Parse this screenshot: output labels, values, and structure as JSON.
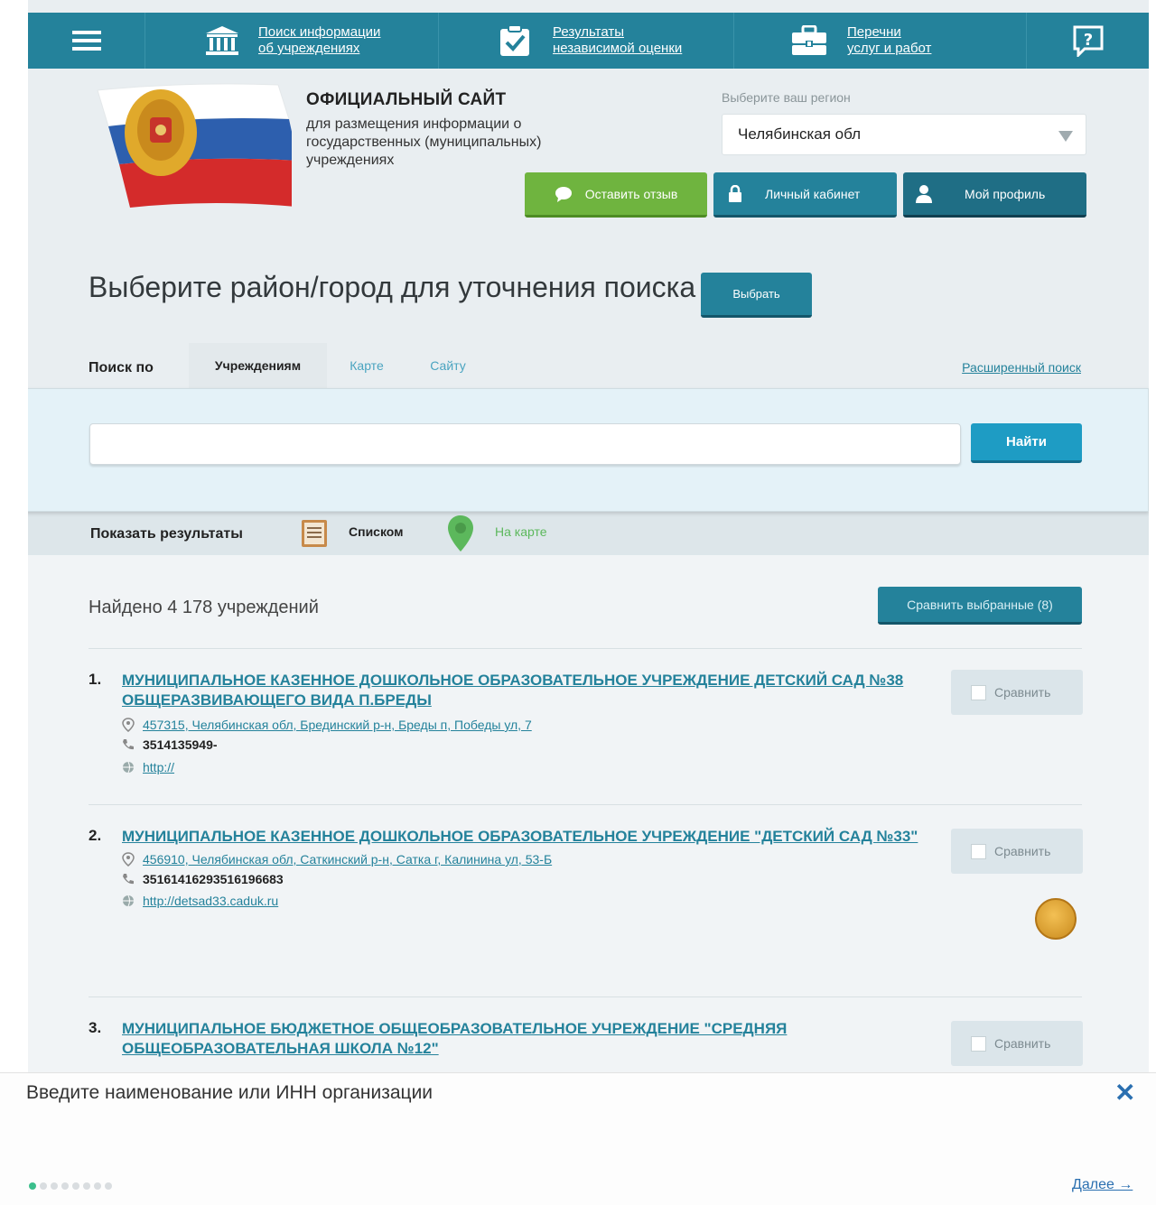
{
  "topnav": {
    "menu_icon": "hamburger-icon",
    "items": [
      {
        "label": "Поиск информации",
        "label2": "об учреждениях",
        "icon": "building-icon"
      },
      {
        "label": "Результаты",
        "label2": "независимой оценки",
        "icon": "checkmark-clipboard-icon"
      },
      {
        "label": "Перечни",
        "label2": "услуг и работ",
        "icon": "briefcase-icon"
      }
    ],
    "help_icon": "help-icon"
  },
  "header": {
    "title": "ОФИЦИАЛЬНЫЙ САЙТ",
    "subtitle": "для размещения информации о государственных (муниципальных) учреждениях",
    "region_label": "Выберите ваш регион",
    "region_value": "Челябинская обл",
    "feedback_button": "Оставить отзыв",
    "cabinet_button": "Личный кабинет",
    "profile_button": "Мой профиль"
  },
  "district": {
    "heading": "Выберите район/город для уточнения поиска",
    "button": "Выбрать"
  },
  "search": {
    "by_label": "Поиск по",
    "tabs": [
      "Учреждениям",
      "Карте",
      "Сайту"
    ],
    "advanced": "Расширенный поиск",
    "input_value": "",
    "button": "Найти"
  },
  "show": {
    "label": "Показать результаты",
    "list": "Списком",
    "map": "На карте"
  },
  "results": {
    "found": "Найдено 4 178 учреждений",
    "compare_button": "Сравнить выбранные (8)",
    "compare_label": "Сравнить",
    "items": [
      {
        "num": "1.",
        "name": "МУНИЦИПАЛЬНОЕ КАЗЕННОЕ ДОШКОЛЬНОЕ ОБРАЗОВАТЕЛЬНОЕ УЧРЕЖДЕНИЕ ДЕТСКИЙ САД №38 ОБЩЕРАЗВИВАЮЩЕГО ВИДА П.БРЕДЫ",
        "address": "457315, Челябинская обл, Брединский р-н, Бреды п, Победы ул, 7",
        "phone": "3514135949-",
        "site": "http://"
      },
      {
        "num": "2.",
        "name": "МУНИЦИПАЛЬНОЕ КАЗЕННОЕ ДОШКОЛЬНОЕ ОБРАЗОВАТЕЛЬНОЕ УЧРЕЖДЕНИЕ \"ДЕТСКИЙ САД №33\"",
        "address": "456910, Челябинская обл, Саткинский р-н, Сатка г, Калинина ул, 53-Б",
        "phone": "35161416293516196683",
        "site": "http://detsad33.caduk.ru"
      },
      {
        "num": "3.",
        "name": "МУНИЦИПАЛЬНОЕ БЮДЖЕТНОЕ ОБЩЕОБРАЗОВАТЕЛЬНОЕ УЧРЕЖДЕНИЕ \"СРЕДНЯЯ ОБЩЕОБРАЗОВАТЕЛЬНАЯ ШКОЛА №12\""
      }
    ]
  },
  "tooltip": {
    "text": "Введите наименование или ИНН организации",
    "next": "Далее →",
    "steps_total": 8,
    "step_current": 1
  },
  "colors": {
    "nav": "#24829b",
    "accent_green": "#6fb43f",
    "link": "#24829b",
    "search_button": "#1e9cc4"
  }
}
